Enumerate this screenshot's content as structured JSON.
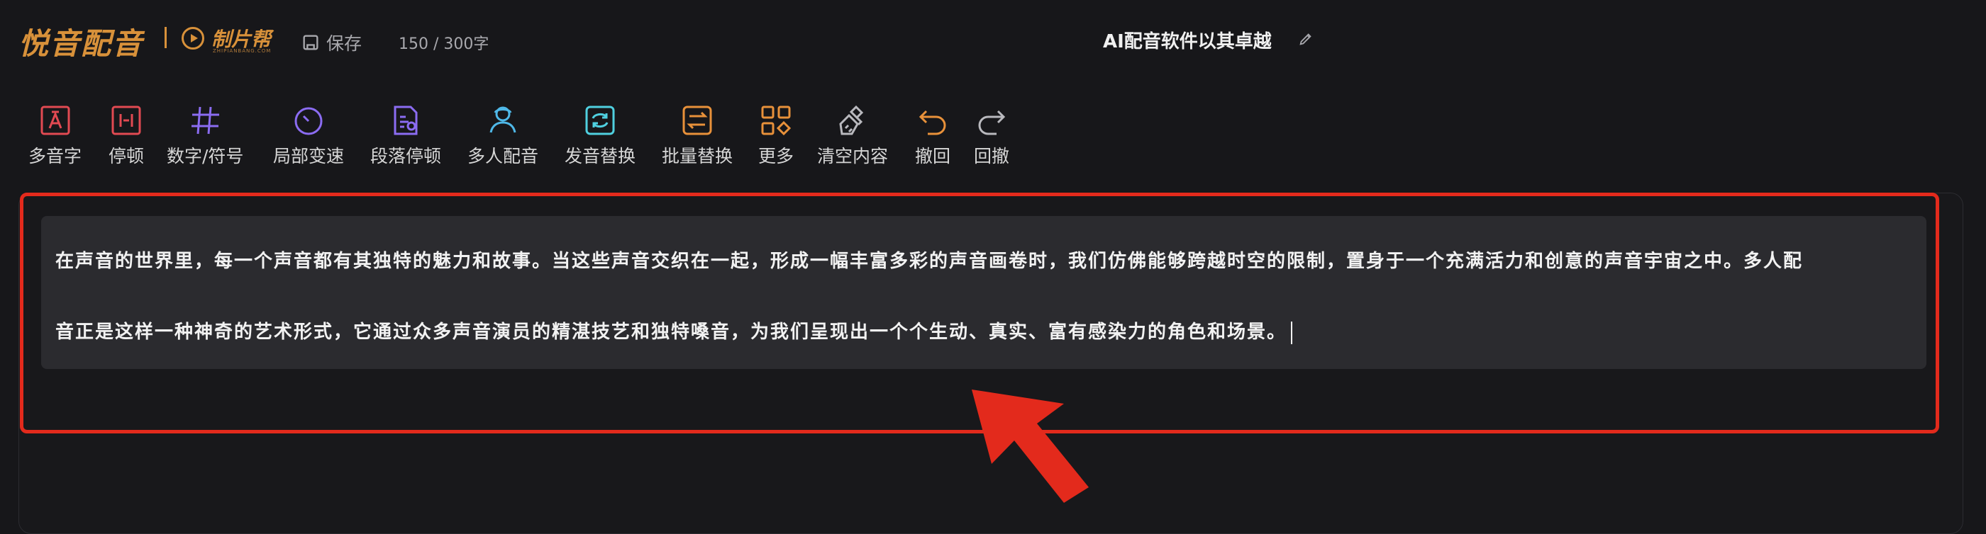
{
  "header": {
    "brand": "悦音配音",
    "partner_name": "制片帮",
    "partner_sub": "ZHIPIANBANG.COM",
    "save_label": "保存",
    "word_count": "150 / 300字",
    "doc_title": "AI配音软件以其卓越"
  },
  "toolbar": {
    "items": [
      {
        "label": "多音字",
        "icon": "polyphone-icon",
        "color": "#e24a52"
      },
      {
        "label": "停顿",
        "icon": "pause-icon",
        "color": "#e24a52"
      },
      {
        "label": "数字/符号",
        "icon": "hash-icon",
        "color": "#8b6cf2"
      },
      {
        "label": "局部变速",
        "icon": "speed-dial-icon",
        "color": "#8b6cf2"
      },
      {
        "label": "段落停顿",
        "icon": "paragraph-pause-icon",
        "color": "#8b6cf2"
      },
      {
        "label": "多人配音",
        "icon": "multi-person-icon",
        "color": "#4fb8e8"
      },
      {
        "label": "发音替换",
        "icon": "pronunciation-replace-icon",
        "color": "#4fd0e0"
      },
      {
        "label": "批量替换",
        "icon": "batch-replace-icon",
        "color": "#e8913a"
      },
      {
        "label": "更多",
        "icon": "more-grid-icon",
        "color": "#e8913a"
      },
      {
        "label": "清空内容",
        "icon": "broom-icon",
        "color": "#b9b9be"
      },
      {
        "label": "撤回",
        "icon": "undo-icon",
        "color": "#e8913a"
      },
      {
        "label": "回撤",
        "icon": "redo-icon",
        "color": "#b9b9be"
      }
    ]
  },
  "editor": {
    "line1": "在声音的世界里，每一个声音都有其独特的魅力和故事。当这些声音交织在一起，形成一幅丰富多彩的声音画卷时，我们仿佛能够跨越时空的限制，置身于一个充满活力和创意的声音宇宙之中。多人配",
    "line2": "音正是这样一种神奇的艺术形式，它通过众多声音演员的精湛技艺和独特嗓音，为我们呈现出一个个生动、真实、富有感染力的角色和场景。"
  },
  "colors": {
    "accent": "#d8913a",
    "highlight_border": "#e32a1c",
    "background": "#17171a",
    "textarea": "#2b2b2f"
  }
}
